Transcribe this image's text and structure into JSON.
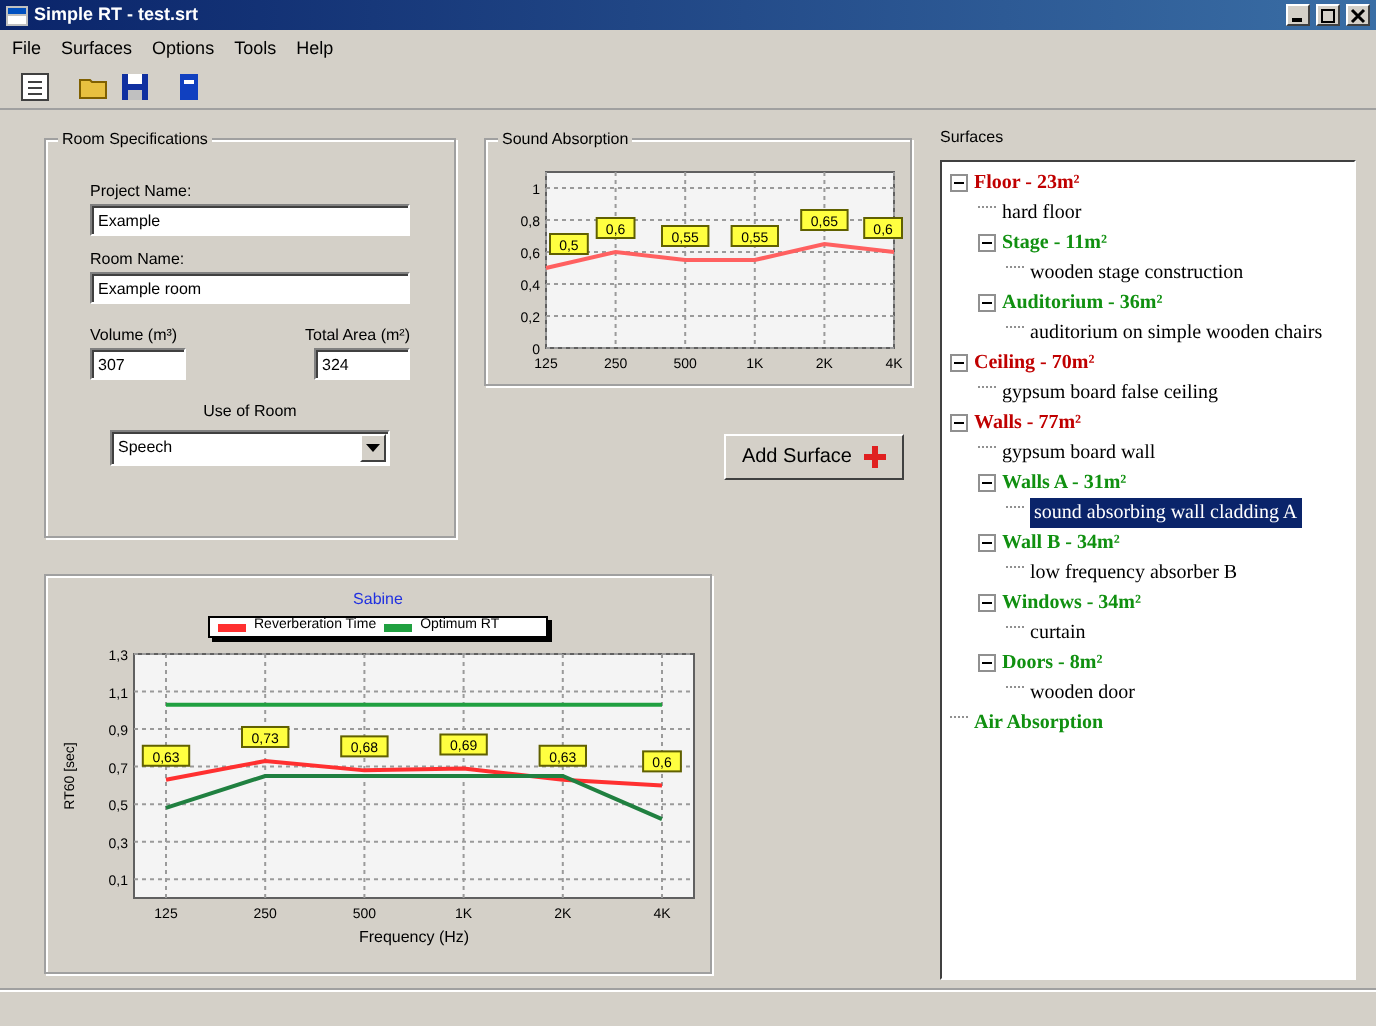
{
  "window": {
    "title": "Simple RT - test.srt"
  },
  "menu": [
    "File",
    "Surfaces",
    "Options",
    "Tools",
    "Help"
  ],
  "room_specifications": {
    "title": "Room Specifications",
    "project_name": {
      "label": "Project Name:",
      "value": "Example"
    },
    "room_name": {
      "label": "Room Name:",
      "value": "Example room"
    },
    "volume": {
      "label": "Volume (m³)",
      "value": "307"
    },
    "total_area": {
      "label": "Total Area (m²)",
      "value": "324"
    },
    "use_of_room": {
      "label": "Use of Room",
      "value": "Speech"
    }
  },
  "sound_absorption": {
    "title": "Sound Absorption",
    "chart_data": {
      "type": "line",
      "categories": [
        "125",
        "250",
        "500",
        "1K",
        "2K",
        "4K"
      ],
      "grid": true,
      "series": [
        {
          "color": "#ff6060",
          "values": [
            0.5,
            0.6,
            0.55,
            0.55,
            0.65,
            0.6
          ]
        }
      ],
      "ylim": [
        0,
        1.1
      ],
      "yticks": [
        {
          "value": 0,
          "label": "0"
        },
        {
          "value": 0.2,
          "label": "0,2"
        },
        {
          "value": 0.4,
          "label": "0,4"
        },
        {
          "value": 0.6,
          "label": "0,6"
        },
        {
          "value": 0.8,
          "label": "0,8"
        },
        {
          "value": 1,
          "label": "1"
        }
      ],
      "value_labels": [
        "0,5",
        "0,6",
        "0,55",
        "0,55",
        "0,65",
        "0,6"
      ]
    }
  },
  "add_surface_button": {
    "label": "Add Surface"
  },
  "rt_chart": {
    "legend": [
      {
        "name": "Reverberation Time",
        "color": "#ff3030"
      },
      {
        "name": "Optimum RT",
        "color": "#20a040"
      }
    ],
    "chart_data": {
      "type": "line",
      "title": "Sabine",
      "xlabel": "Frequency (Hz)",
      "ylabel": "RT60 [sec]",
      "categories": [
        "125",
        "250",
        "500",
        "1K",
        "2K",
        "4K"
      ],
      "grid": true,
      "series": [
        {
          "color": "#ff3030",
          "values": [
            0.63,
            0.73,
            0.68,
            0.69,
            0.63,
            0.6
          ]
        },
        {
          "color": "#20a040",
          "values": [
            1.03,
            1.03,
            1.03,
            1.03,
            1.03,
            1.03
          ]
        },
        {
          "color": "#208040",
          "values": [
            0.48,
            0.65,
            0.65,
            0.65,
            0.65,
            0.42
          ]
        }
      ],
      "ylim": [
        0,
        1.3
      ],
      "yticks": [
        {
          "value": 0.1,
          "label": "0,1"
        },
        {
          "value": 0.3,
          "label": "0,3"
        },
        {
          "value": 0.5,
          "label": "0,5"
        },
        {
          "value": 0.7,
          "label": "0,7"
        },
        {
          "value": 0.9,
          "label": "0,9"
        },
        {
          "value": 1.1,
          "label": "1,1"
        },
        {
          "value": 1.3,
          "label": "1,3"
        }
      ],
      "value_labels": [
        "0,63",
        "0,73",
        "0,68",
        "0,69",
        "0,63",
        "0,6"
      ]
    }
  },
  "surfaces": {
    "title": "Surfaces",
    "tree": [
      {
        "kind": "surface",
        "label": "Floor - 23m²",
        "expanded": true,
        "selected": false,
        "children": [
          {
            "kind": "material",
            "label": "hard floor",
            "selected": false
          },
          {
            "kind": "subsurface",
            "label": "Stage - 11m²",
            "expanded": true,
            "selected": false,
            "children": [
              {
                "kind": "material",
                "label": "wooden stage construction",
                "selected": false
              }
            ]
          },
          {
            "kind": "subsurface",
            "label": "Auditorium - 36m²",
            "expanded": true,
            "selected": false,
            "children": [
              {
                "kind": "material",
                "label": "auditorium on simple wooden chairs",
                "selected": false
              }
            ]
          }
        ]
      },
      {
        "kind": "surface",
        "label": "Ceiling - 70m²",
        "expanded": true,
        "selected": false,
        "children": [
          {
            "kind": "material",
            "label": "gypsum board false ceiling",
            "selected": false
          }
        ]
      },
      {
        "kind": "surface",
        "label": "Walls - 77m²",
        "expanded": true,
        "selected": false,
        "children": [
          {
            "kind": "material",
            "label": "gypsum board wall",
            "selected": false
          },
          {
            "kind": "subsurface",
            "label": "Walls A - 31m²",
            "expanded": true,
            "selected": false,
            "children": [
              {
                "kind": "material",
                "label": "sound absorbing wall cladding A",
                "selected": true
              }
            ]
          },
          {
            "kind": "subsurface",
            "label": "Wall B - 34m²",
            "expanded": true,
            "selected": false,
            "children": [
              {
                "kind": "material",
                "label": "low frequency absorber B",
                "selected": false
              }
            ]
          },
          {
            "kind": "subsurface",
            "label": "Windows - 34m²",
            "expanded": true,
            "selected": false,
            "children": [
              {
                "kind": "material",
                "label": "curtain",
                "selected": false
              }
            ]
          },
          {
            "kind": "subsurface",
            "label": "Doors - 8m²",
            "expanded": true,
            "selected": false,
            "children": [
              {
                "kind": "material",
                "label": "wooden door",
                "selected": false
              }
            ]
          }
        ]
      },
      {
        "kind": "subsurface",
        "label": "Air Absorption",
        "selected": false
      }
    ]
  }
}
